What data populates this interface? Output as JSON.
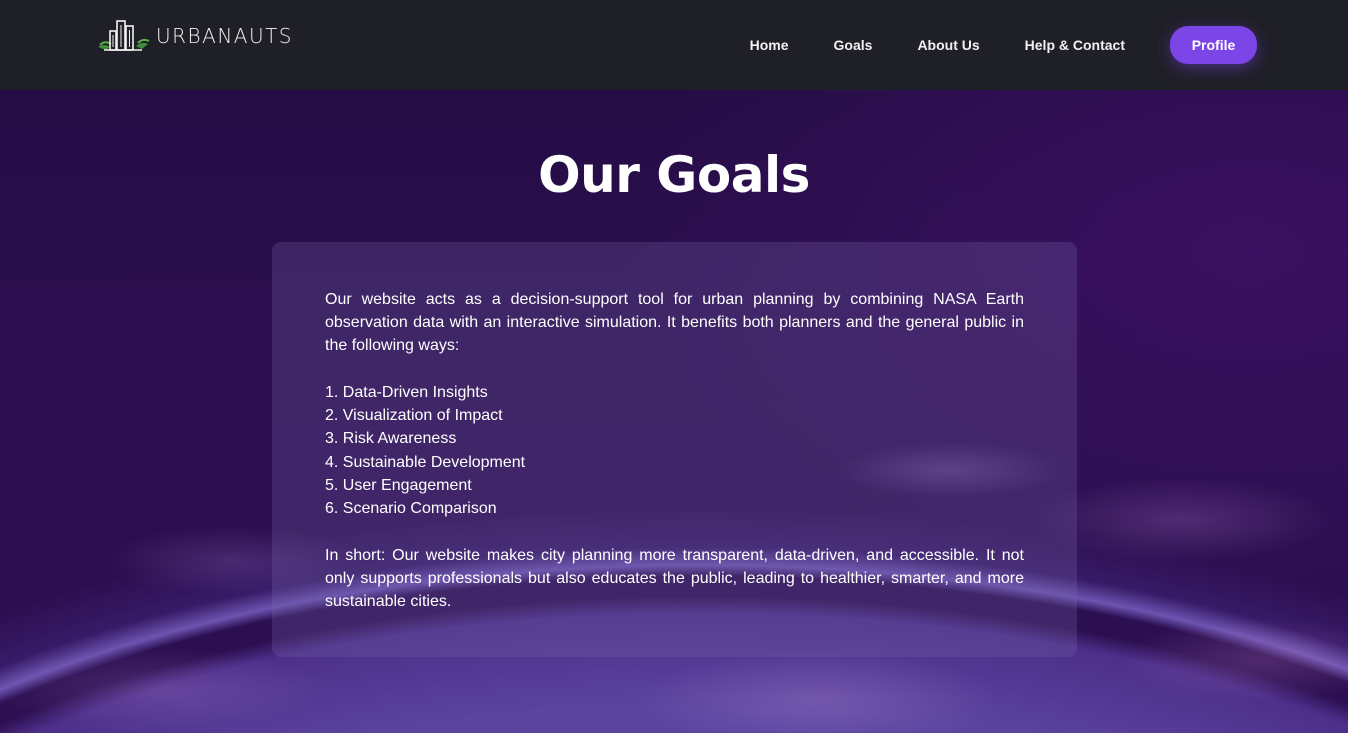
{
  "brand": {
    "name": "URBANAUTS",
    "logo_icon": "city-buildings-icon"
  },
  "nav": {
    "items": [
      "Home",
      "Goals",
      "About Us",
      "Help & Contact"
    ],
    "profile_label": "Profile",
    "accent_color": "#7c45e8"
  },
  "page": {
    "title": "Our Goals"
  },
  "content": {
    "intro": "Our website acts as a decision-support tool for urban planning by combining NASA Earth observation data with an interactive simulation. It benefits both planners and the general public in the following ways:",
    "goals": [
      "1. Data-Driven Insights",
      "2. Visualization of Impact",
      "3. Risk Awareness",
      "4. Sustainable Development",
      "5. User Engagement",
      "6. Scenario Comparison"
    ],
    "outro": "In short: Our website makes city planning more transparent, data-driven, and accessible. It not only supports professionals but also educates the public, leading to healthier, smarter, and more sustainable cities."
  }
}
